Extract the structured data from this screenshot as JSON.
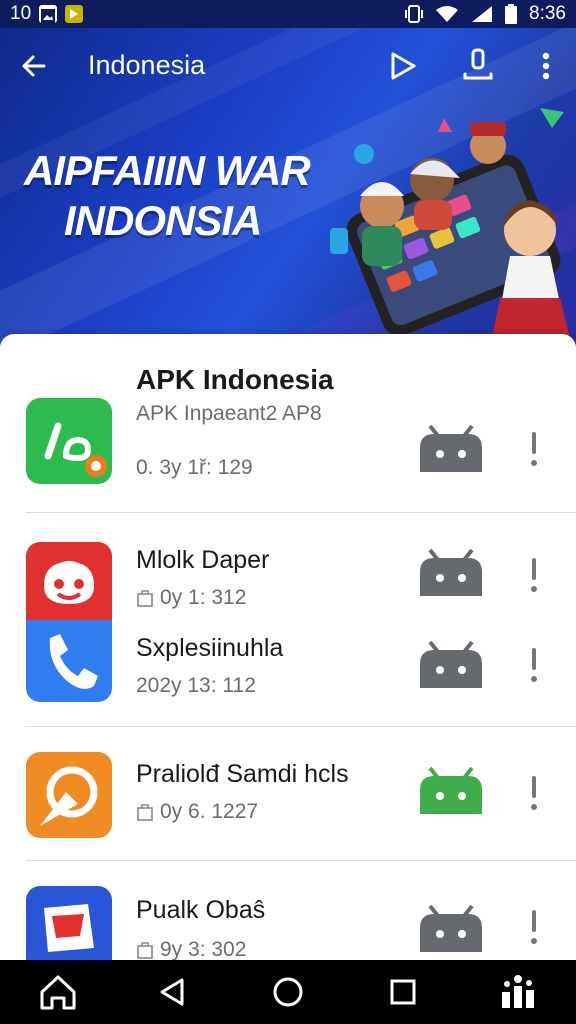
{
  "status_bar": {
    "time_left": "10",
    "time_right": "8:36"
  },
  "app_bar": {
    "title": "Indonesia"
  },
  "hero": {
    "line1": "AIPFAIIIN WAR",
    "line2": "INDONSIA"
  },
  "apps": [
    {
      "title": "APK Indonesia",
      "subtitle": "APK Inpaeant2 AP8",
      "meta": "0. 3y 1ř: 129",
      "icon": "ld-logo-icon",
      "icon_color": "#2dbb4d",
      "android_color": "#666a6e"
    },
    {
      "title": "Mlolk Daper",
      "meta": "0y 1: 312",
      "icon": "smiley-face-icon",
      "icon_color": "#e03030",
      "android_color": "#666a6e"
    },
    {
      "title": "Sxplesiinuhla",
      "meta": "202y 13: 112",
      "icon": "phone-icon",
      "icon_color": "#2f7df0",
      "android_color": "#666a6e"
    },
    {
      "title": "Praliolđ Samdi hcls",
      "meta": "0y 6. 1227",
      "icon": "compass-icon",
      "icon_color": "#f08a22",
      "android_color": "#3fae4a"
    },
    {
      "title": "Pualk Obaŝ",
      "meta": "9y 3: 302",
      "icon": "tag-icon",
      "icon_color": "#2a55d6",
      "android_color": "#666a6e"
    }
  ],
  "colors": {
    "hero_bg": "#1a3fc4",
    "android_default": "#666a6e",
    "android_active": "#3fae4a"
  }
}
